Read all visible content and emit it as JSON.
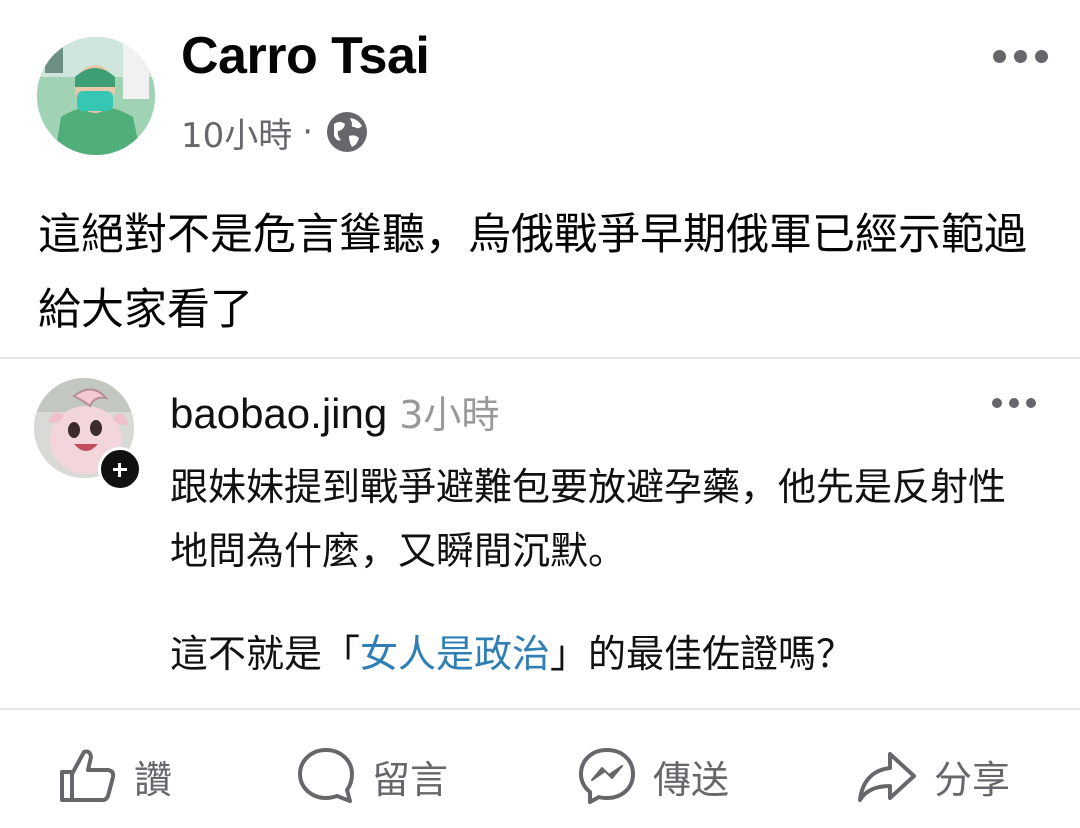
{
  "post": {
    "author": "Carro Tsai",
    "time": "10小時",
    "separator": "·",
    "visibility_icon": "globe-icon",
    "more_icon": "more-horizontal-icon",
    "text": "這絕對不是危言聳聽，烏俄戰爭早期俄軍已經示範過給大家看了"
  },
  "quoted": {
    "username": "baobao.jing",
    "time": "3小時",
    "follow_icon": "plus-icon",
    "more_icon": "more-horizontal-icon",
    "body": "跟妹妹提到戰爭避難包要放避孕藥，他先是反射性地問為什麼，又瞬間沉默。",
    "tail_before": "這不就是「",
    "tail_link": "女人是政治",
    "tail_after": "」的最佳佐證嗎？"
  },
  "actions": [
    {
      "label": "讚",
      "icon": "thumbs-up-icon"
    },
    {
      "label": "留言",
      "icon": "comment-icon"
    },
    {
      "label": "傳送",
      "icon": "messenger-icon"
    },
    {
      "label": "分享",
      "icon": "share-icon"
    }
  ],
  "colors": {
    "secondary_text": "#65676b",
    "hashtag": "#2f7fb4",
    "divider": "#e4e6eb"
  }
}
